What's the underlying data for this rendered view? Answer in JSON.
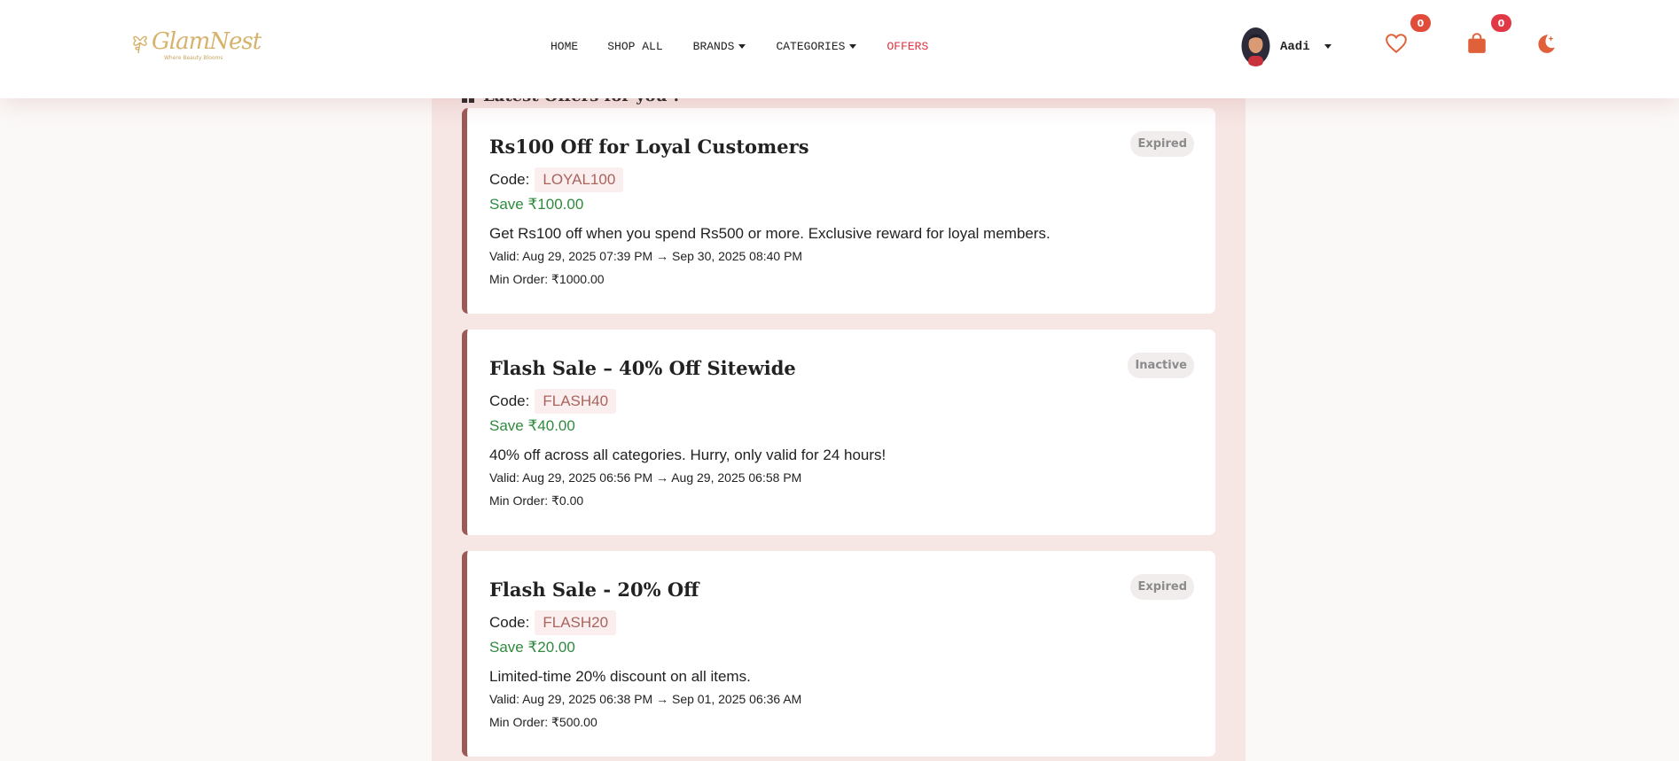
{
  "brand": {
    "name": "GlamNest",
    "tagline": "Where Beauty Blooms"
  },
  "nav": {
    "items": [
      {
        "label": "HOME",
        "dropdown": false,
        "active": false
      },
      {
        "label": "SHOP ALL",
        "dropdown": false,
        "active": false
      },
      {
        "label": "BRANDS",
        "dropdown": true,
        "active": false
      },
      {
        "label": "CATEGORIES",
        "dropdown": true,
        "active": false
      },
      {
        "label": "OFFERS",
        "dropdown": false,
        "active": true
      }
    ]
  },
  "user": {
    "name": "Aadi"
  },
  "wishlist": {
    "count": "0"
  },
  "cart": {
    "count": "0"
  },
  "section": {
    "heading": "Latest Offers for you !"
  },
  "offers": [
    {
      "title": "Rs100 Off for Loyal Customers",
      "status": "Expired",
      "code_label": "Code:",
      "code": "LOYAL100",
      "save": "Save ₹100.00",
      "description": "Get Rs100 off when you spend Rs500 or more. Exclusive reward for loyal members.",
      "validity": "Valid: Aug 29, 2025 07:39 PM → Sep 30, 2025 08:40 PM",
      "min_order": "Min Order: ₹1000.00"
    },
    {
      "title": "Flash Sale – 40% Off Sitewide",
      "status": "Inactive",
      "code_label": "Code:",
      "code": "FLASH40",
      "save": "Save ₹40.00",
      "description": "40% off across all categories. Hurry, only valid for 24 hours!",
      "validity": "Valid: Aug 29, 2025 06:56 PM → Aug 29, 2025 06:58 PM",
      "min_order": "Min Order: ₹0.00"
    },
    {
      "title": "Flash Sale - 20% Off",
      "status": "Expired",
      "code_label": "Code:",
      "code": "FLASH20",
      "save": "Save ₹20.00",
      "description": "Limited-time 20% discount on all items.",
      "validity": "Valid: Aug 29, 2025 06:38 PM → Sep 01, 2025 06:36 AM",
      "min_order": "Min Order: ₹500.00"
    }
  ],
  "colors": {
    "accent": "#e0303f",
    "card_border": "#9b5a55",
    "panel_bg": "#f6e6e4",
    "save_green": "#2f8a3e",
    "icon_orange": "#e0603a"
  }
}
